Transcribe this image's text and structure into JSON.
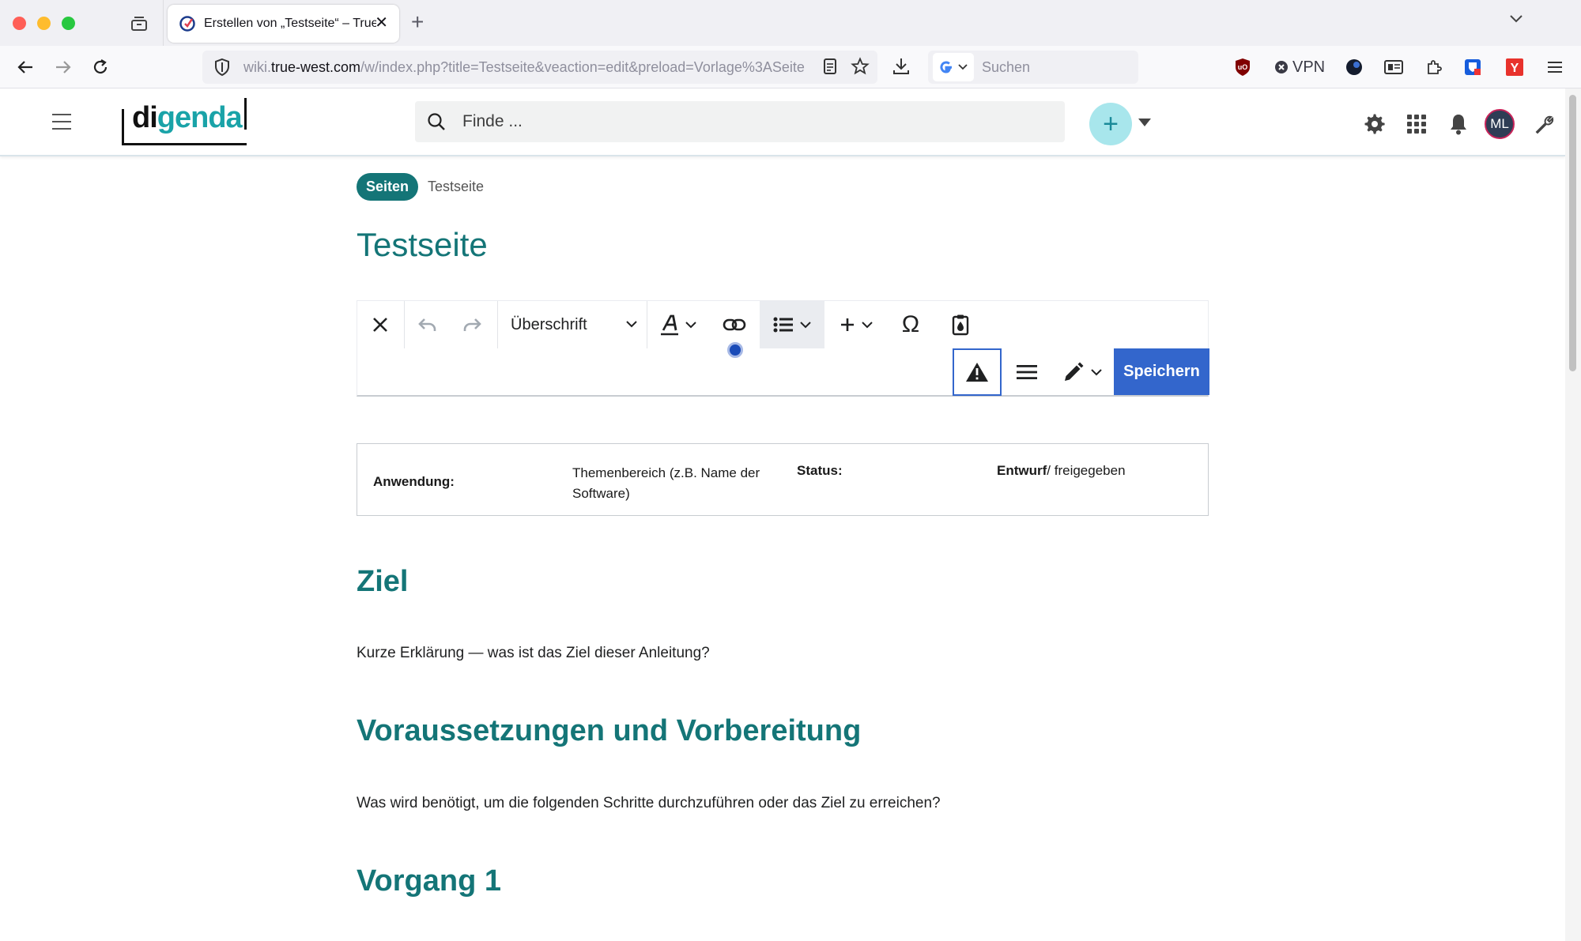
{
  "browser": {
    "tab_title": "Erstellen von „Testseite“ – True-West Wiki",
    "url_prefix": "wiki.",
    "url_domain": "true-west.com",
    "url_rest": "/w/index.php?title=Testseite&veaction=edit&preload=Vorlage%3ASeite",
    "search_placeholder": "Suchen",
    "vpn_label": "VPN"
  },
  "header": {
    "logo_di": "di",
    "logo_genda": "genda",
    "search_placeholder": "Finde ...",
    "add_label": "+",
    "avatar_initials": "ML"
  },
  "breadcrumb": {
    "section": "Seiten",
    "current": "Testseite"
  },
  "page": {
    "title": "Testseite"
  },
  "toolbar": {
    "format_label": "Überschrift",
    "special_char": "Ω",
    "save_label": "Speichern"
  },
  "info_table": {
    "c1_label": "Anwendung:",
    "c2_text": "Themenbereich (z.B. Name der Software)",
    "c3_label": "Status:",
    "c4_bold": "Entwurf",
    "c4_rest": "/ freigegeben"
  },
  "sections": [
    {
      "heading": "Ziel",
      "text": "Kurze Erklärung — was ist das Ziel dieser Anleitung?"
    },
    {
      "heading": "Voraussetzungen und Vorbereitung",
      "text": "Was wird benötigt, um die folgenden Schritte durchzuführen oder das Ziel zu erreichen?"
    },
    {
      "heading": "Vorgang 1"
    }
  ],
  "colors": {
    "accent_teal": "#147577",
    "save_blue": "#3366cc",
    "logo_teal": "#1aa3a8"
  }
}
